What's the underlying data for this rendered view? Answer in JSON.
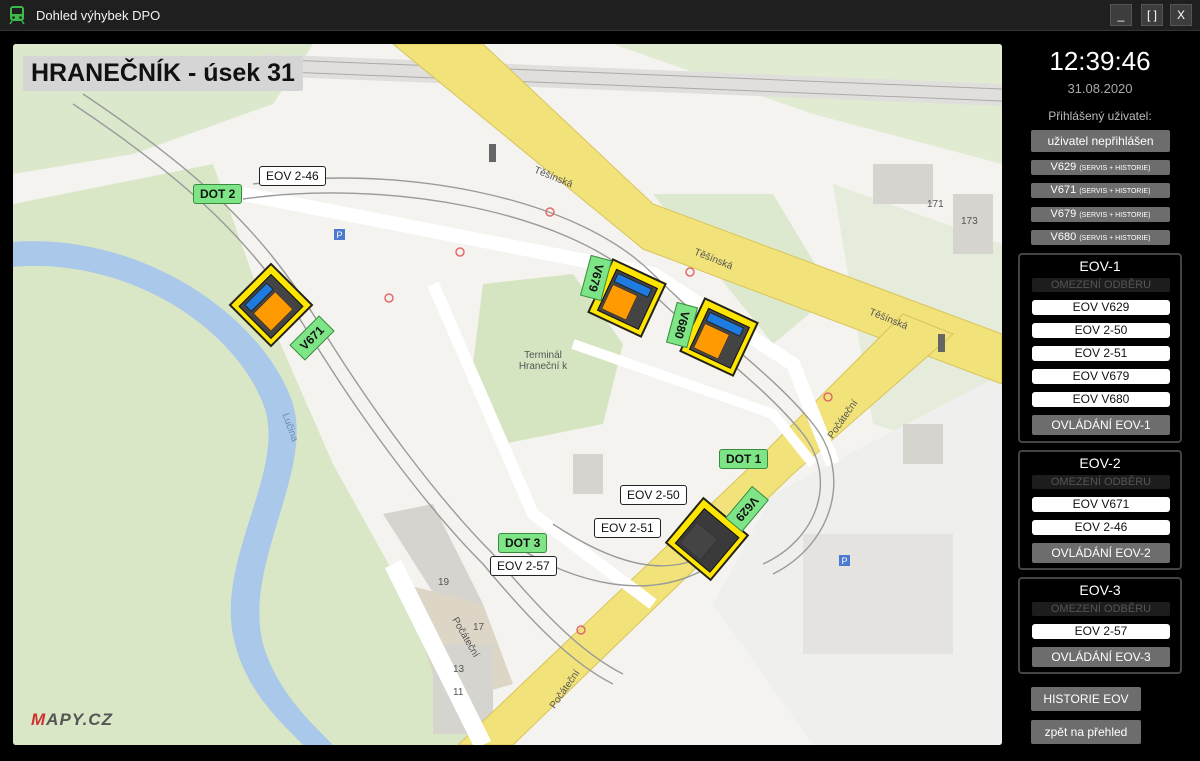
{
  "window": {
    "title": "Dohled výhybek DPO",
    "minimize": "_",
    "maximize": "[ ]",
    "close": "X"
  },
  "map": {
    "section_title": "HRANEČNÍK - úsek 31",
    "logo_prefix": "M",
    "logo_rest": "APY.CZ",
    "dots": {
      "dot1": "DOT 1",
      "dot2": "DOT 2",
      "dot3": "DOT 3"
    },
    "eov_tags": {
      "eov_2_46": "EOV 2-46",
      "eov_2_50": "EOV 2-50",
      "eov_2_51": "EOV 2-51",
      "eov_2_57": "EOV 2-57"
    },
    "switches": {
      "v671": "V671",
      "v679": "V679",
      "v680": "V680",
      "v629": "V629"
    },
    "streets": {
      "tesinska_1": "Těšínská",
      "tesinska_2": "Těšínská",
      "tesinska_3": "Těšínská",
      "pocatecni_1": "Počáteční",
      "pocatecni_2": "Počáteční",
      "pocatecni_3": "Počáteční",
      "lucina": "Lučina",
      "terminal": "Terminál Hraneční k",
      "house_171": "171",
      "house_173": "173",
      "house_19": "19",
      "house_17": "17",
      "house_13": "13",
      "house_11": "11"
    }
  },
  "sidebar": {
    "time": "12:39:46",
    "date": "31.08.2020",
    "login_label": "Přihlášený uživatel:",
    "user_button": "uživatel nepřihlášen",
    "service_suffix": "(SERVIS + HISTORIE)",
    "switch_buttons": [
      "V629",
      "V671",
      "V679",
      "V680"
    ],
    "groups": [
      {
        "title": "EOV-1",
        "limit": "OMEZENÍ ODBĚRU",
        "rows": [
          "EOV V629",
          "EOV 2-50",
          "EOV 2-51",
          "EOV V679",
          "EOV V680"
        ],
        "control": "OVLÁDÁNÍ EOV-1"
      },
      {
        "title": "EOV-2",
        "limit": "OMEZENÍ ODBĚRU",
        "rows": [
          "EOV V671",
          "EOV 2-46"
        ],
        "control": "OVLÁDÁNÍ EOV-2"
      },
      {
        "title": "EOV-3",
        "limit": "OMEZENÍ ODBĚRU",
        "rows": [
          "EOV 2-57"
        ],
        "control": "OVLÁDÁNÍ EOV-3"
      }
    ],
    "history_button": "HISTORIE EOV",
    "back_button": "zpět na přehled"
  },
  "colors": {
    "switch_frame": "#ffe600",
    "switch_body": "#444444",
    "switch_orange": "#ff9a00",
    "switch_blue": "#1e7be0",
    "dot_tag": "#7ee586",
    "road_yellow": "#f2e27a",
    "river": "#a9c8ea",
    "park": "#d9e7c6"
  }
}
